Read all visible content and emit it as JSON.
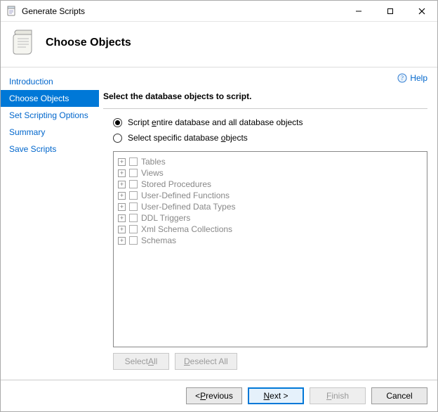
{
  "window": {
    "title": "Generate Scripts"
  },
  "header": {
    "page_title": "Choose Objects"
  },
  "help": {
    "label": "Help"
  },
  "sidebar": {
    "items": [
      {
        "label": "Introduction"
      },
      {
        "label": "Choose Objects"
      },
      {
        "label": "Set Scripting Options"
      },
      {
        "label": "Summary"
      },
      {
        "label": "Save Scripts"
      }
    ],
    "active_index": 1
  },
  "content": {
    "instruction": "Select the database objects to script.",
    "radio_entire": {
      "prefix": "Script ",
      "hotkey": "e",
      "suffix": "ntire database and all database objects",
      "checked": true
    },
    "radio_specific": {
      "prefix": "Select specific database ",
      "hotkey": "o",
      "suffix": "bjects",
      "checked": false
    },
    "tree": [
      {
        "label": "Tables"
      },
      {
        "label": "Views"
      },
      {
        "label": "Stored Procedures"
      },
      {
        "label": "User-Defined Functions"
      },
      {
        "label": "User-Defined Data Types"
      },
      {
        "label": "DDL Triggers"
      },
      {
        "label": "Xml Schema Collections"
      },
      {
        "label": "Schemas"
      }
    ],
    "select_all": {
      "prefix": "Select ",
      "hotkey": "A",
      "suffix": "ll"
    },
    "deselect_all": {
      "hotkey": "D",
      "suffix": "eselect All"
    }
  },
  "footer": {
    "previous": {
      "prefix": "< ",
      "hotkey": "P",
      "suffix": "revious"
    },
    "next": {
      "hotkey": "N",
      "suffix": "ext >"
    },
    "finish": {
      "hotkey": "F",
      "suffix": "inish"
    },
    "cancel": {
      "label": "Cancel"
    }
  }
}
